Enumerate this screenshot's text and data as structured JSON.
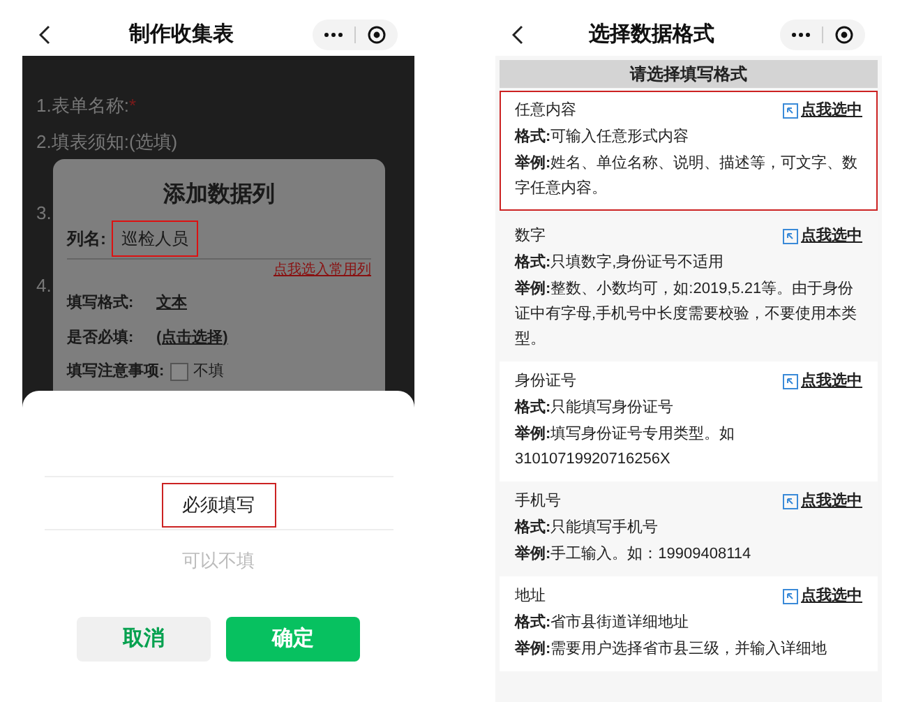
{
  "left_screen": {
    "title": "制作收集表",
    "background_items": [
      {
        "text": "1.表单名称:",
        "required_mark": "*"
      },
      {
        "text": "2.填表须知:(选填)"
      },
      {
        "text": "3."
      },
      {
        "text": "4."
      }
    ],
    "dialog": {
      "title": "添加数据列",
      "column_name": {
        "label": "列名:",
        "value": "巡检人员",
        "highlighted": true
      },
      "common_link": "点我选入常用列",
      "rows": [
        {
          "label": "填写格式:",
          "value": "文本"
        },
        {
          "label": "是否必填:",
          "value": "(点击选择)"
        }
      ],
      "notes": {
        "label": "填写注意事项:",
        "checked": false,
        "option": "不填"
      }
    },
    "picker": {
      "options": [
        {
          "label": "必须填写",
          "selected": true,
          "highlighted": true
        },
        {
          "label": "可以不填",
          "selected": false,
          "highlighted": false
        }
      ],
      "buttons": [
        {
          "label": "取消",
          "kind": "cancel"
        },
        {
          "label": "确定",
          "kind": "confirm"
        }
      ]
    }
  },
  "right_screen": {
    "title": "选择数据格式",
    "banner": "请选择填写格式",
    "formats": [
      {
        "name": "任意内容",
        "action": "点我选中",
        "format_label": "格式:",
        "format": "可输入任意形式内容",
        "example_label": "举例:",
        "example": "姓名、单位名称、说明、描述等，可文字、数字任意内容。",
        "highlighted": true
      },
      {
        "name": "数字",
        "action": "点我选中",
        "format_label": "格式:",
        "format": "只填数字,身份证号不适用",
        "example_label": "举例:",
        "example": "整数、小数均可，如:2019,5.21等。由于身份证中有字母,手机号中长度需要校验，不要使用本类型。",
        "highlighted": false
      },
      {
        "name": "身份证号",
        "action": "点我选中",
        "format_label": "格式:",
        "format": "只能填写身份证号",
        "example_label": "举例:",
        "example": "填写身份证号专用类型。如 31010719920716256X",
        "highlighted": false
      },
      {
        "name": "手机号",
        "action": "点我选中",
        "format_label": "格式:",
        "format": "只能填写手机号",
        "example_label": "举例:",
        "example": "手工输入。如：19909408114",
        "highlighted": false
      },
      {
        "name": "地址",
        "action": "点我选中",
        "format_label": "格式:",
        "format": "省市县街道详细地址",
        "example_label": "举例:",
        "example": "需要用户选择省市县三级，并输入详细地",
        "highlighted": false
      }
    ]
  }
}
